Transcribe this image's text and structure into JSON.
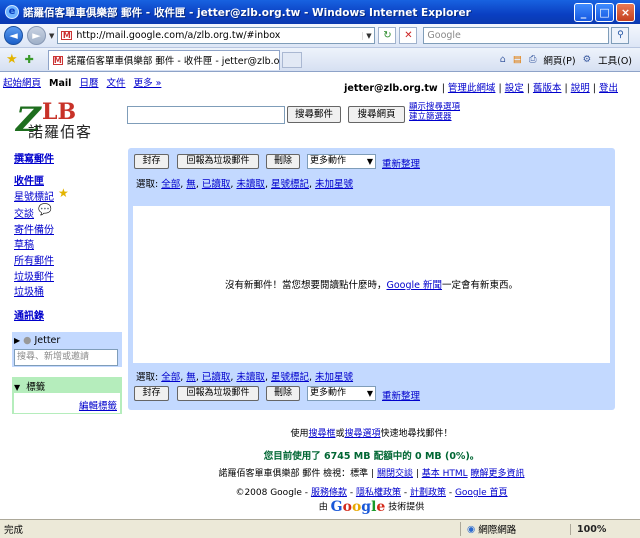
{
  "window": {
    "title": "諾羅佰客單車俱樂部 郵件 - 收件匣 - jetter@zlb.org.tw - Windows Internet Explorer",
    "minimize_icon": "minimize-icon",
    "maximize_icon": "maximize-icon",
    "close_icon": "close-icon"
  },
  "addressbar": {
    "url": "http://mail.google.com/a/zlb.org.tw/#inbox",
    "search_placeholder": "Google"
  },
  "tabbar": {
    "tab_title": "諾羅佰客單車俱樂部 郵件 - 收件匣 - jetter@zlb.org...",
    "page_menu": "網頁(P)",
    "tools_menu": "工具(O)"
  },
  "topnav": {
    "items": [
      "起始網頁",
      "Mail",
      "日曆",
      "文件",
      "更多 »"
    ]
  },
  "userbar": {
    "email": "jetter@zlb.org.tw",
    "links": [
      "管理此網域",
      "設定",
      "舊版本",
      "說明",
      "登出"
    ]
  },
  "logo": {
    "letters": "ZLB",
    "name": "諾羅佰客"
  },
  "search": {
    "search_mail": "搜尋郵件",
    "search_web": "搜尋網頁",
    "show_options": "顯示搜尋選項",
    "create_filter": "建立篩選器"
  },
  "leftnav": {
    "compose": "撰寫郵件",
    "inbox": "收件匣",
    "starred": "星號標記",
    "chats": "交談",
    "sent": "寄件備份",
    "drafts": "草稿",
    "all_mail": "所有郵件",
    "spam": "垃圾郵件",
    "trash": "垃圾桶",
    "contacts": "通訊錄"
  },
  "chat": {
    "name": "Jetter",
    "placeholder": "搜尋、新增或邀請"
  },
  "labels": {
    "title": "標籤",
    "edit": "編輯標籤"
  },
  "toolbar": {
    "archive": "封存",
    "report_spam": "回報為垃圾郵件",
    "delete": "刪除",
    "more_actions": "更多動作",
    "refresh": "重新整理"
  },
  "selection": {
    "prefix": "選取:",
    "options": [
      "全部",
      "無",
      "已讀取",
      "未讀取",
      "星號標記",
      "未加星號"
    ]
  },
  "empty": {
    "before": "沒有新郵件！當您想要閱讀點什麼時，",
    "link": "Google 新聞",
    "after": "一定會有新東西。"
  },
  "footer": {
    "tip_before": "使用",
    "tip_link1": "搜尋框",
    "tip_mid": "或",
    "tip_link2": "搜尋選項",
    "tip_after": "快速地尋找郵件！",
    "usage": "您目前使用了 6745 MB 配額中的 0 MB (0%)。",
    "view_prefix": "諾羅佰客單車俱樂部 郵件 檢視：標準 |",
    "view_links": [
      "關閉交談",
      "基本 HTML",
      "瞭解更多資訊"
    ],
    "copyright": "©2008 Google -",
    "policy_links": [
      "服務條款",
      "隱私權政策",
      "計劃政策",
      "Google 首頁"
    ],
    "powered_before": "由",
    "powered_logo": "Google",
    "powered_after": "技術提供"
  },
  "statusbar": {
    "status": "完成",
    "zone": "網際網路",
    "zoom": "100%"
  }
}
